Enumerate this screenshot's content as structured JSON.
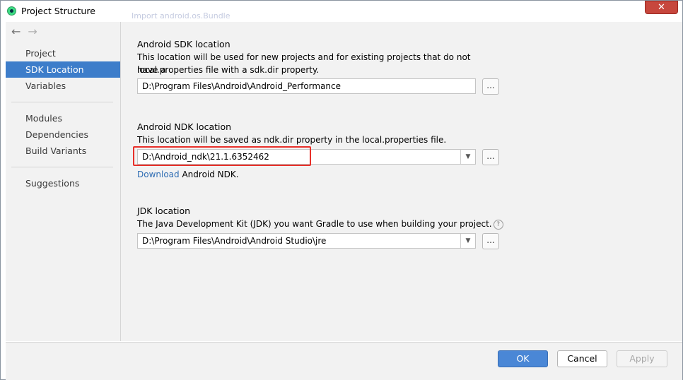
{
  "window": {
    "title": "Project Structure",
    "close_glyph": "✕",
    "background_tab_text": "Import android.os.Bundle"
  },
  "sidebar": {
    "back_glyph": "←",
    "forward_glyph": "→",
    "items": [
      {
        "label": "Project"
      },
      {
        "label": "SDK Location",
        "selected": true
      },
      {
        "label": "Variables"
      },
      {
        "label": "Modules"
      },
      {
        "label": "Dependencies"
      },
      {
        "label": "Build Variants"
      },
      {
        "label": "Suggestions"
      }
    ]
  },
  "sdk": {
    "title": "Android SDK location",
    "desc_line1": "This location will be used for new projects and for existing projects that do not have a",
    "desc_line2": "local.properties file with a sdk.dir property.",
    "value": "D:\\Program Files\\Android\\Android_Performance",
    "browse_label": "..."
  },
  "ndk": {
    "title": "Android NDK location",
    "desc": "This location will be saved as ndk.dir property in the local.properties file.",
    "value": "D:\\Android_ndk\\21.1.6352462",
    "dropdown_glyph": "▼",
    "browse_label": "...",
    "download_link": "Download",
    "download_suffix": " Android NDK."
  },
  "jdk": {
    "title": "JDK location",
    "desc": "The Java Development Kit (JDK) you want Gradle to use when building your project.",
    "help_glyph": "?",
    "value": "D:\\Program Files\\Android\\Android Studio\\jre",
    "dropdown_glyph": "▼",
    "browse_label": "..."
  },
  "footer": {
    "ok": "OK",
    "cancel": "Cancel",
    "apply": "Apply"
  },
  "colors": {
    "selection": "#3d7dca",
    "highlight_box": "#e8302a",
    "link": "#2f6db3",
    "primary_button": "#4a87d6",
    "close_button": "#c7473d"
  }
}
